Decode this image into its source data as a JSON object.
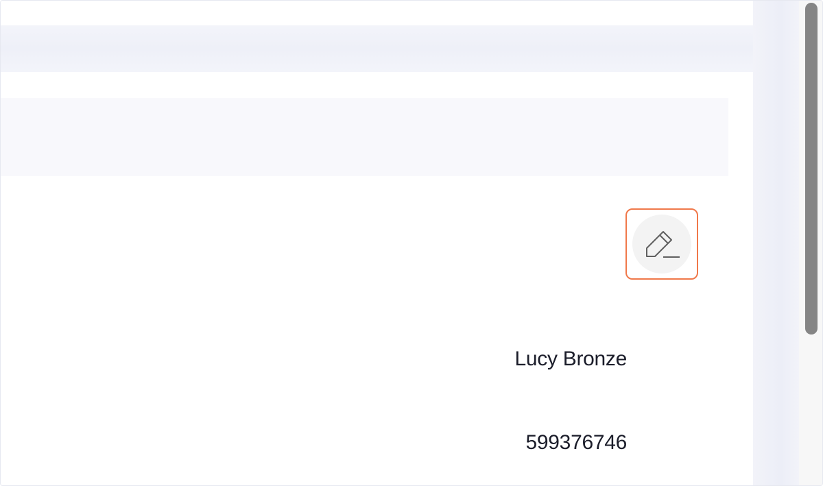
{
  "profile": {
    "name": "Lucy Bronze",
    "number": "599376746"
  },
  "edit_button": {
    "icon": "pencil-edit-icon"
  },
  "colors": {
    "highlight_border": "#f0784a",
    "text": "#1b1d2a",
    "scrollbar_thumb": "#858585"
  }
}
